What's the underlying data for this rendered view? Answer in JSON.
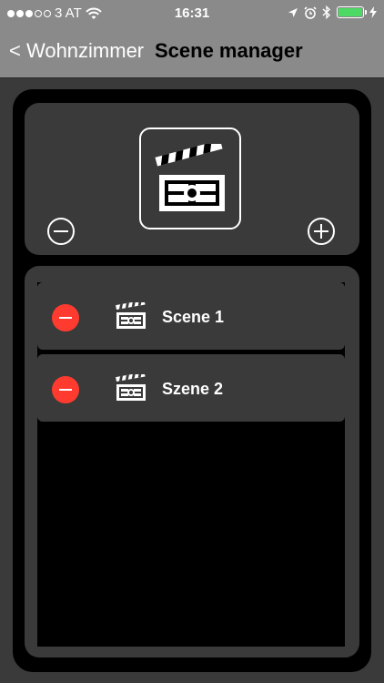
{
  "status_bar": {
    "carrier": "3 AT",
    "time": "16:31",
    "battery_color": "#4cd964"
  },
  "nav": {
    "back_label": "< Wohnzimmer",
    "title": "Scene manager"
  },
  "scenes": [
    {
      "label": "Scene 1"
    },
    {
      "label": "Szene 2"
    }
  ],
  "colors": {
    "delete": "#ff3b30",
    "panel": "#3a3a3a",
    "frame": "#000000"
  },
  "icons": {
    "main": "clapperboard-icon",
    "remove": "minus-circle-icon",
    "add": "plus-circle-icon"
  }
}
